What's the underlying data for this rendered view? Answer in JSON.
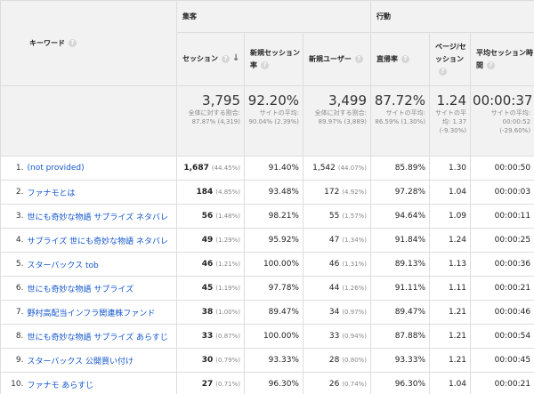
{
  "groups": {
    "acquisition": "集客",
    "behavior": "行動"
  },
  "headers": {
    "keyword": "キーワード",
    "sessions": "セッション",
    "new_session_rate": "新規セッション率",
    "new_users": "新規ユーザー",
    "bounce_rate": "直帰率",
    "pages_per_session": "ページ/セッション",
    "avg_session_duration": "平均セッション時間"
  },
  "totals": {
    "sessions": {
      "value": "3,795",
      "note": "全体に対する割合: 87.87% (4,319)"
    },
    "new_session_rate": {
      "value": "92.20%",
      "note": "サイトの平均: 90.04% (2.39%)"
    },
    "new_users": {
      "value": "3,499",
      "note": "全体に対する割合: 89.97% (3,889)"
    },
    "bounce_rate": {
      "value": "87.72%",
      "note": "サイトの平均: 86.59% (1.30%)"
    },
    "pages_per_session": {
      "value": "1.24",
      "note": "サイトの平均: 1.37 (-9.30%)"
    },
    "avg_session_duration": {
      "value": "00:00:37",
      "note": "サイトの平均: 00:00:52 (-29.60%)"
    }
  },
  "rows": [
    {
      "idx": "1.",
      "keyword": "(not provided)",
      "sessions": "1,687",
      "sessions_pct": "(44.45%)",
      "new_rate": "91.40%",
      "new_users": "1,542",
      "new_users_pct": "(44.07%)",
      "bounce": "85.89%",
      "pps": "1.30",
      "dur": "00:00:50"
    },
    {
      "idx": "2.",
      "keyword": "ファナモとは",
      "sessions": "184",
      "sessions_pct": "(4.85%)",
      "new_rate": "93.48%",
      "new_users": "172",
      "new_users_pct": "(4.92%)",
      "bounce": "97.28%",
      "pps": "1.04",
      "dur": "00:00:03"
    },
    {
      "idx": "3.",
      "keyword": "世にも奇妙な物語 サプライズ ネタバレ",
      "sessions": "56",
      "sessions_pct": "(1.48%)",
      "new_rate": "98.21%",
      "new_users": "55",
      "new_users_pct": "(1.57%)",
      "bounce": "94.64%",
      "pps": "1.09",
      "dur": "00:00:11"
    },
    {
      "idx": "4.",
      "keyword": "サプライズ 世にも奇妙な物語 ネタバレ",
      "sessions": "49",
      "sessions_pct": "(1.29%)",
      "new_rate": "95.92%",
      "new_users": "47",
      "new_users_pct": "(1.34%)",
      "bounce": "91.84%",
      "pps": "1.24",
      "dur": "00:00:25"
    },
    {
      "idx": "5.",
      "keyword": "スターバックス tob",
      "sessions": "46",
      "sessions_pct": "(1.21%)",
      "new_rate": "100.00%",
      "new_users": "46",
      "new_users_pct": "(1.31%)",
      "bounce": "89.13%",
      "pps": "1.13",
      "dur": "00:00:36"
    },
    {
      "idx": "6.",
      "keyword": "世にも奇妙な物語 サプライズ",
      "sessions": "45",
      "sessions_pct": "(1.19%)",
      "new_rate": "97.78%",
      "new_users": "44",
      "new_users_pct": "(1.26%)",
      "bounce": "91.11%",
      "pps": "1.11",
      "dur": "00:00:21"
    },
    {
      "idx": "7.",
      "keyword": "野村高配当インフラ関連株ファンド",
      "sessions": "38",
      "sessions_pct": "(1.00%)",
      "new_rate": "89.47%",
      "new_users": "34",
      "new_users_pct": "(0.97%)",
      "bounce": "89.47%",
      "pps": "1.21",
      "dur": "00:00:46"
    },
    {
      "idx": "8.",
      "keyword": "世にも奇妙な物語 サプライズ あらすじ",
      "sessions": "33",
      "sessions_pct": "(0.87%)",
      "new_rate": "100.00%",
      "new_users": "33",
      "new_users_pct": "(0.94%)",
      "bounce": "87.88%",
      "pps": "1.21",
      "dur": "00:00:54"
    },
    {
      "idx": "9.",
      "keyword": "スターバックス 公開買い付け",
      "sessions": "30",
      "sessions_pct": "(0.79%)",
      "new_rate": "93.33%",
      "new_users": "28",
      "new_users_pct": "(0.80%)",
      "bounce": "93.33%",
      "pps": "1.21",
      "dur": "00:00:45"
    },
    {
      "idx": "10.",
      "keyword": "ファナモ あらすじ",
      "sessions": "27",
      "sessions_pct": "(0.71%)",
      "new_rate": "96.30%",
      "new_users": "26",
      "new_users_pct": "(0.74%)",
      "bounce": "96.30%",
      "pps": "1.04",
      "dur": "00:00:21"
    }
  ]
}
